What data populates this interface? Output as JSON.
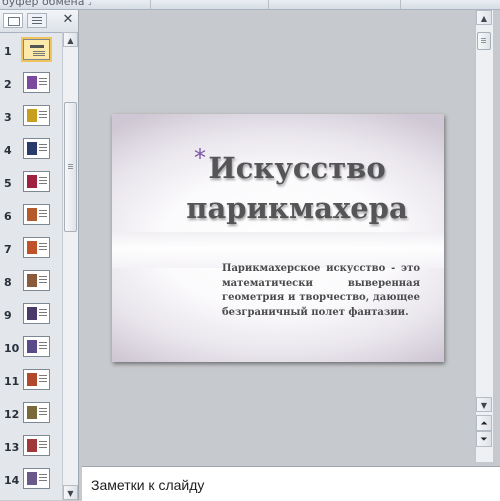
{
  "ribbon": {
    "group_label": "буфер обмена"
  },
  "pane": {
    "close_symbol": "✕",
    "tabs": [
      {
        "name": "slides-tab",
        "active": true
      },
      {
        "name": "outline-tab",
        "active": false
      }
    ],
    "selected_slide": 1,
    "slides": [
      "1",
      "2",
      "3",
      "4",
      "5",
      "6",
      "7",
      "8",
      "9",
      "10",
      "11",
      "12",
      "13",
      "14"
    ]
  },
  "slide": {
    "title": "Искусство парикмахера",
    "body": "Парикмахерское искусство - это математически выверенная геометрия и творчество, дающее безграничный полет фантазии.",
    "bullet_symbol": "*"
  },
  "notes": {
    "placeholder": "Заметки к слайду"
  },
  "colors": {
    "accent": "#7a56a4",
    "selection": "#f1c35c",
    "workspace": "#c6c9cd"
  },
  "icons": {
    "scroll_up": "▲",
    "scroll_down": "▼",
    "prev_slide": "⏶",
    "next_slide": "⏷"
  }
}
